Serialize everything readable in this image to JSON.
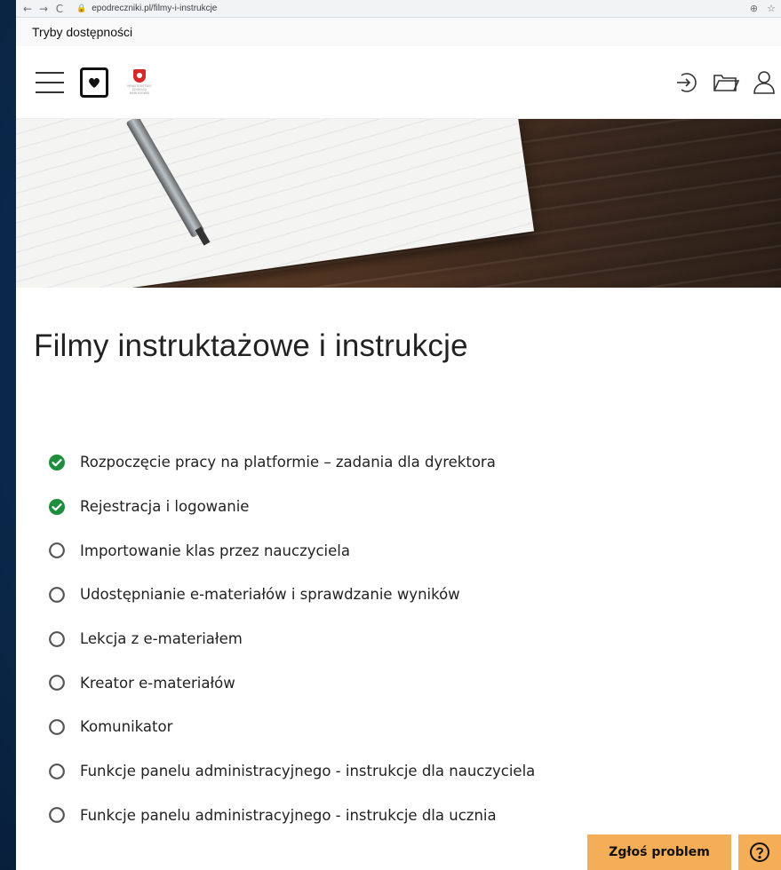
{
  "browser": {
    "url": "epodreczniki.pl/filmy-i-instrukcje",
    "back_icon": "←",
    "forward_icon": "→",
    "reload_icon": "C",
    "lock_icon": "🔒",
    "zoom_icon": "⊕",
    "star_icon": "☆"
  },
  "a11y": {
    "label": "Tryby dostępności"
  },
  "header": {
    "ministry_text": "MINISTERSTWO EDUKACJI NARODOWEJ"
  },
  "page": {
    "title": "Filmy instruktażowe i instrukcje"
  },
  "items": [
    {
      "label": "Rozpoczęcie pracy na platformie – zadania dla dyrektora",
      "done": true
    },
    {
      "label": "Rejestracja i logowanie",
      "done": true
    },
    {
      "label": "Importowanie klas przez nauczyciela",
      "done": false
    },
    {
      "label": "Udostępnianie e-materiałów i sprawdzanie wyników",
      "done": false
    },
    {
      "label": "Lekcja z e-materiałem",
      "done": false
    },
    {
      "label": "Kreator e-materiałów",
      "done": false
    },
    {
      "label": "Komunikator",
      "done": false
    },
    {
      "label": "Funkcje panelu administracyjnego - instrukcje dla nauczyciela",
      "done": false
    },
    {
      "label": "Funkcje panelu administracyjnego - instrukcje dla ucznia",
      "done": false
    }
  ],
  "footer": {
    "report_label": "Zgłoś problem"
  },
  "colors": {
    "done": "#1e8e3e",
    "todo": "#555555",
    "accent": "#f4ae57"
  }
}
